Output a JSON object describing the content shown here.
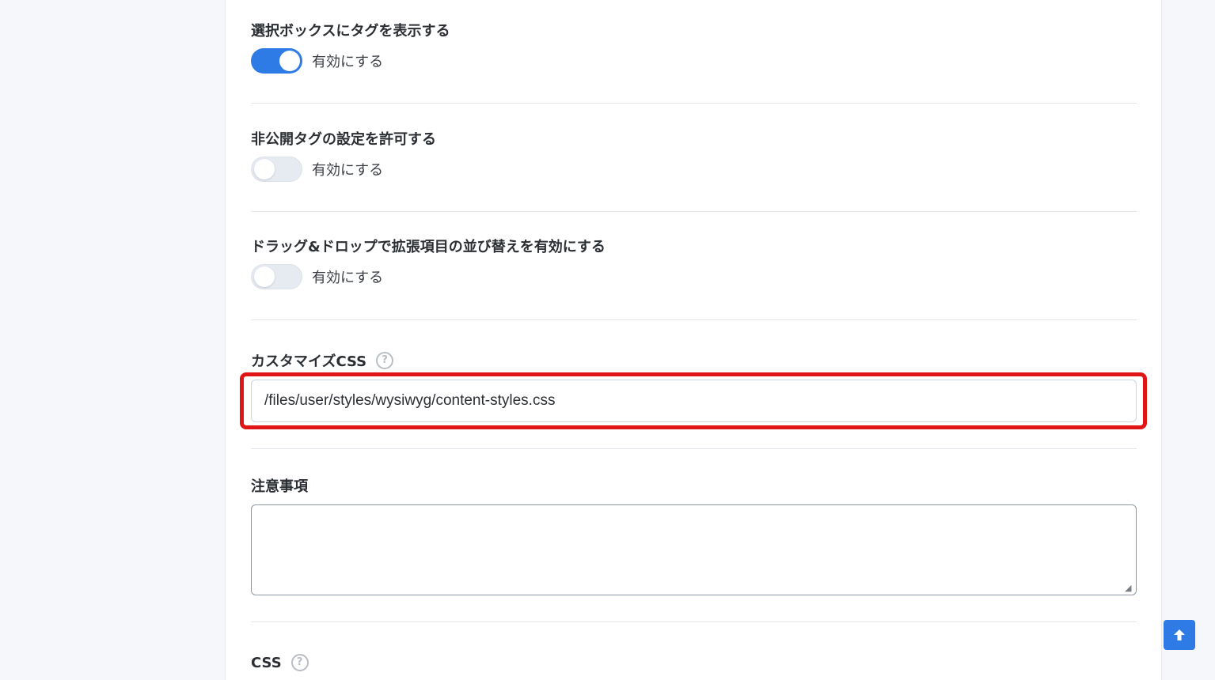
{
  "settings": {
    "show_tags": {
      "label": "選択ボックスにタグを表示する",
      "toggle_label": "有効にする",
      "enabled": true
    },
    "private_tags": {
      "label": "非公開タグの設定を許可する",
      "toggle_label": "有効にする",
      "enabled": false
    },
    "drag_drop": {
      "label": "ドラッグ&ドロップで拡張項目の並び替えを有効にする",
      "toggle_label": "有効にする",
      "enabled": false
    },
    "custom_css": {
      "label": "カスタマイズCSS",
      "help_icon": "question-circle-icon",
      "value": "/files/user/styles/wysiwyg/content-styles.css"
    },
    "notes": {
      "label": "注意事項",
      "value": ""
    },
    "css": {
      "label": "CSS",
      "help_icon": "question-circle-icon"
    }
  },
  "colors": {
    "accent": "#2f7be5",
    "highlight": "#e01515"
  },
  "scroll_top_icon": "arrow-up-icon"
}
